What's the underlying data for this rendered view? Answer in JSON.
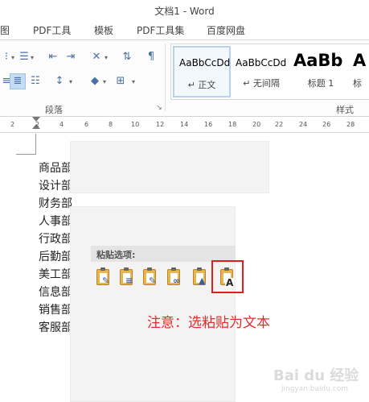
{
  "window": {
    "title": "文档1 - Word"
  },
  "tabs": [
    {
      "label": "图"
    },
    {
      "label": "PDF工具"
    },
    {
      "label": "模板"
    },
    {
      "label": "PDF工具集"
    },
    {
      "label": "百度网盘"
    }
  ],
  "ribbon": {
    "paragraph_group_label": "段落",
    "styles_group_label": "样式",
    "styles": [
      {
        "preview": "AaBbCcDd",
        "name": "↵ 正文",
        "active": true
      },
      {
        "preview": "AaBbCcDd",
        "name": "↵ 无间隔",
        "active": false
      },
      {
        "preview": "AaBb",
        "name": "标题 1",
        "active": false
      },
      {
        "preview": "A",
        "name": "标",
        "active": false
      }
    ]
  },
  "ruler": {
    "ticks": [
      "2",
      "2",
      "4",
      "6",
      "8",
      "10",
      "12",
      "14",
      "16",
      "18",
      "20",
      "22",
      "24",
      "26",
      "28"
    ]
  },
  "document": {
    "lines": [
      "商品部",
      "设计部",
      "财务部",
      "人事部",
      "行政部",
      "后勤部",
      "美工部",
      "信息部",
      "销售部",
      "客服部"
    ]
  },
  "context_menu": {
    "paste_options_label": "粘贴选项:",
    "options": [
      {
        "icon": "paste-keep-source-formatting-icon"
      },
      {
        "icon": "paste-merge-formatting-icon"
      },
      {
        "icon": "paste-use-destination-styles-icon"
      },
      {
        "icon": "paste-link-icon"
      },
      {
        "icon": "paste-picture-icon"
      },
      {
        "icon": "paste-text-only-icon",
        "badge": "A"
      }
    ]
  },
  "annotation": {
    "text": "注意：选粘贴为文本"
  },
  "watermark": {
    "text": "Bai du 经验",
    "subtext": "jingyan.baidu.com"
  }
}
